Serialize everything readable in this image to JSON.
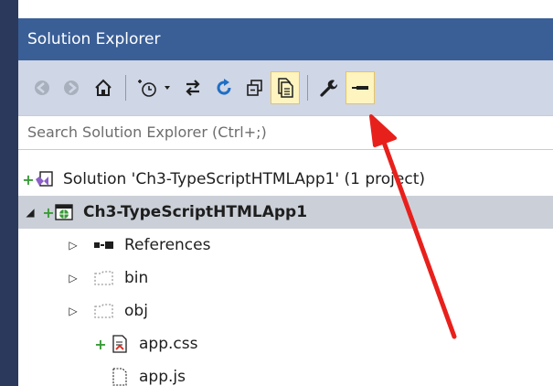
{
  "window": {
    "title": "Solution Explorer"
  },
  "toolbar": {
    "back_icon": "back-arrow-icon",
    "forward_icon": "forward-arrow-icon",
    "home_icon": "home-icon",
    "pending_changes_icon": "pending-changes-filter-icon",
    "dropdown_icon": "chevron-down-icon",
    "sync_icon": "sync-with-active-document-icon",
    "refresh_icon": "refresh-icon",
    "collapse_icon": "collapse-all-icon",
    "show_all_files_icon": "show-all-files-icon",
    "properties_icon": "wrench-icon",
    "preview_icon": "preview-selected-items-icon"
  },
  "search": {
    "placeholder": "Search Solution Explorer (Ctrl+;)"
  },
  "tree": {
    "solution_label": "Solution 'Ch3-TypeScriptHTMLApp1' (1 project)",
    "project_label": "Ch3-TypeScriptHTMLApp1",
    "items": [
      {
        "label": "References",
        "icon": "references-icon",
        "expandable": true
      },
      {
        "label": "bin",
        "icon": "hidden-folder-icon",
        "expandable": true
      },
      {
        "label": "obj",
        "icon": "hidden-folder-icon",
        "expandable": true
      },
      {
        "label": "app.css",
        "icon": "css-file-icon",
        "expandable": false,
        "added": true
      },
      {
        "label": "app.js",
        "icon": "file-icon",
        "expandable": false,
        "added": false
      }
    ]
  },
  "colors": {
    "title_bar": "#3a5f97",
    "toolbar": "#cfd6e5",
    "highlight": "#fdf4bf",
    "selected_row": "#cbd0d8",
    "annotation_arrow": "#e8201c"
  }
}
